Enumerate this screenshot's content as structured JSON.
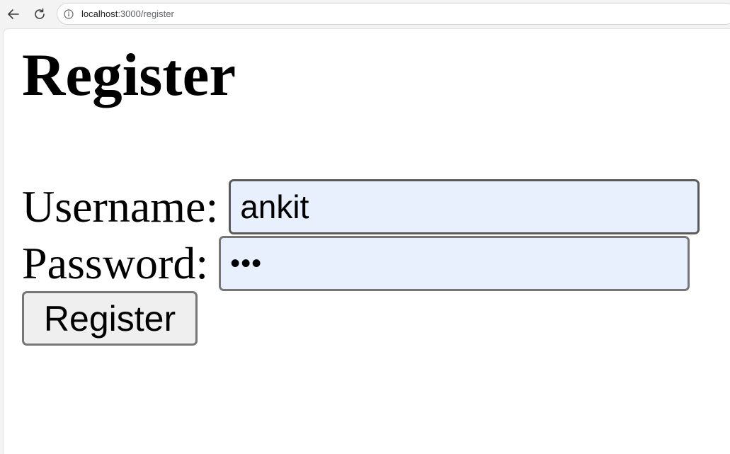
{
  "browser": {
    "url_host": "localhost",
    "url_path": ":3000/register"
  },
  "page": {
    "title": "Register",
    "username_label": "Username:",
    "username_value": "ankit",
    "password_label": "Password:",
    "password_value": "•••",
    "submit_label": "Register"
  },
  "colors": {
    "autofill_background": "#e8f0fe",
    "button_background": "#efefef",
    "field_border": "#767676"
  }
}
